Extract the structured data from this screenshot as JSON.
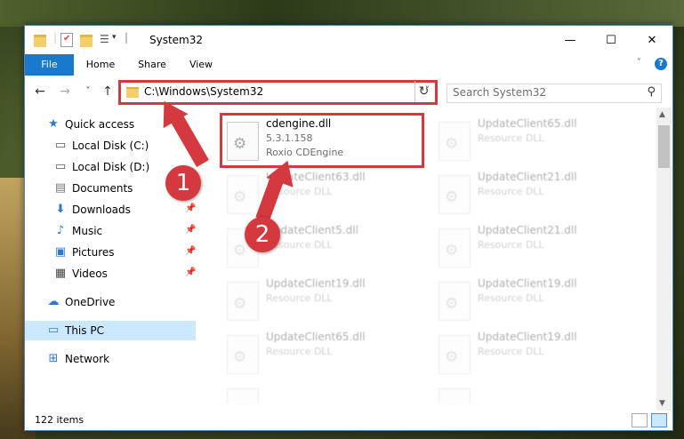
{
  "window": {
    "title": "System32",
    "controls": {
      "minimize": "—",
      "maximize": "☐",
      "close": "✕"
    }
  },
  "ribbon": {
    "tabs": [
      "File",
      "Home",
      "Share",
      "View"
    ]
  },
  "nav": {
    "back": "←",
    "forward": "→",
    "recent": "˅",
    "up": "↑",
    "address": "C:\\Windows\\System32",
    "search_placeholder": "Search System32"
  },
  "sidebar": {
    "items": [
      {
        "label": "Quick access",
        "icon": "star-icon"
      },
      {
        "label": "Local Disk (C:)",
        "icon": "drive-icon"
      },
      {
        "label": "Local Disk (D:)",
        "icon": "drive-icon"
      },
      {
        "label": "Documents",
        "icon": "documents-icon"
      },
      {
        "label": "Downloads",
        "icon": "download-icon"
      },
      {
        "label": "Music",
        "icon": "music-icon"
      },
      {
        "label": "Pictures",
        "icon": "pictures-icon"
      },
      {
        "label": "Videos",
        "icon": "videos-icon"
      },
      {
        "label": "OneDrive",
        "icon": "cloud-icon"
      },
      {
        "label": "This PC",
        "icon": "computer-icon"
      },
      {
        "label": "Network",
        "icon": "network-icon"
      }
    ]
  },
  "files": [
    {
      "name": "cdengine.dll",
      "line2": "5.3.1.158",
      "line3": "Roxio CDEngine"
    },
    {
      "name": "UpdateClient65.dll",
      "line2": "Resource DLL"
    },
    {
      "name": "UpdateClient63.dll",
      "line2": "Resource DLL"
    },
    {
      "name": "UpdateClient21.dll",
      "line2": "Resource DLL"
    },
    {
      "name": "UpdateClient5.dll",
      "line2": "Resource DLL"
    },
    {
      "name": "UpdateClient21.dll",
      "line2": "Resource DLL"
    },
    {
      "name": "UpdateClient19.dll",
      "line2": "Resource DLL"
    },
    {
      "name": "UpdateClient19.dll",
      "line2": "Resource DLL"
    },
    {
      "name": "UpdateClient65.dll",
      "line2": "Resource DLL"
    },
    {
      "name": "UpdateClient19.dll",
      "line2": "Resource DLL"
    }
  ],
  "status": {
    "count": "122 items"
  },
  "callouts": {
    "one": "1",
    "two": "2"
  },
  "colors": {
    "accent": "#1979ca",
    "highlight": "#d3393f",
    "selected": "#cce8ff"
  }
}
